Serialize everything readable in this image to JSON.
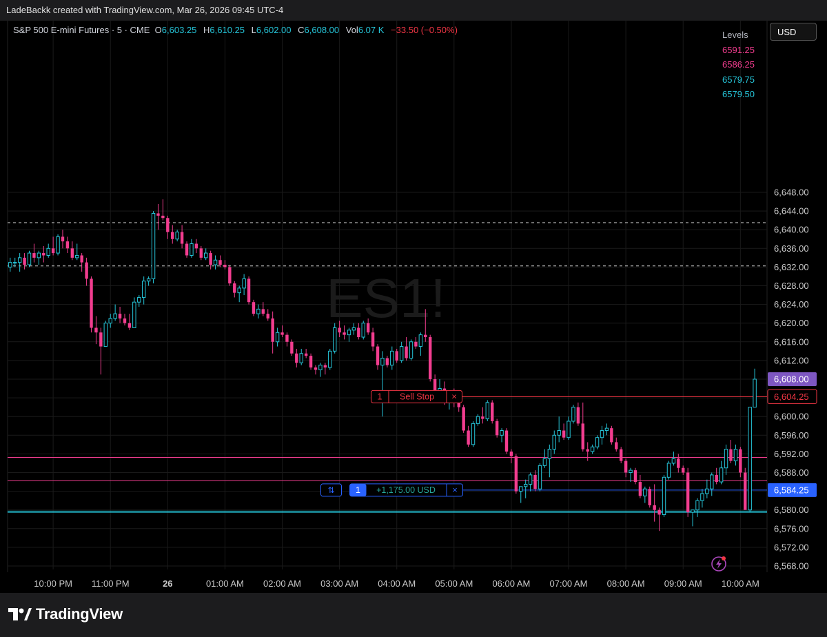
{
  "attribution": "LadeBackk created with TradingView.com, Mar 26, 2026 09:45 UTC-4",
  "brand": "TradingView",
  "watermark": "ES1!",
  "symbol_header": {
    "title": "S&P 500 E-mini Futures · 5 · CME",
    "o_label": "O",
    "o_value": "6,603.25",
    "h_label": "H",
    "h_value": "6,610.25",
    "l_label": "L",
    "l_value": "6,602.00",
    "c_label": "C",
    "c_value": "6,608.00",
    "vol_label": "Vol",
    "vol_value": "6.07 K",
    "change": "−33.50 (−0.50%)"
  },
  "currency_button": "USD",
  "levels_panel": {
    "title": "Levels",
    "items": [
      {
        "label": "6591.25",
        "color": "#f23d8f"
      },
      {
        "label": "6586.25",
        "color": "#f23d8f"
      },
      {
        "label": "6579.75",
        "color": "#26c6da"
      },
      {
        "label": "6579.50",
        "color": "#26c6da"
      }
    ]
  },
  "order": {
    "qty": "1",
    "label": "Sell Stop",
    "close": "×",
    "price": 6604.25,
    "price_label": "6,604.25",
    "color": "#f23645"
  },
  "position": {
    "icon": "swap-icon",
    "qty": "1",
    "pnl": "+1,175.00 USD",
    "close": "×",
    "price": 6584.25,
    "price_label": "6,584.25",
    "color": "#2962ff",
    "pnl_color": "#26a69a"
  },
  "last_price": {
    "price": 6608,
    "label": "6,608.00",
    "color": "#7e57c2"
  },
  "colors": {
    "up": "#26c6da",
    "down": "#f23d8f",
    "grid": "#1a1a1a",
    "axis_text": "#c9c9c9",
    "dashed": "#d8d8d8"
  },
  "chart_data": {
    "type": "candlestick",
    "symbol": "ES1!",
    "interval": "5",
    "y_axis": {
      "ticks": [
        6568,
        6572,
        6576,
        6580,
        6584,
        6588,
        6592,
        6596,
        6600,
        6604,
        6608,
        6612,
        6616,
        6620,
        6624,
        6628,
        6632,
        6636,
        6640,
        6644,
        6648
      ],
      "tick_labels": [
        "6,568.00",
        "6,572.00",
        "6,576.00",
        "6,580.00",
        "6,584.00",
        "6,588.00",
        "6,592.00",
        "6,596.00",
        "6,600.00",
        "6,604.00",
        "6,608.00",
        "6,612.00",
        "6,616.00",
        "6,620.00",
        "6,624.00",
        "6,628.00",
        "6,632.00",
        "6,636.00",
        "6,640.00",
        "6,644.00",
        "6,648.00"
      ],
      "range": [
        6567,
        6651
      ]
    },
    "x_axis": {
      "tick_labels": [
        "10:00 PM",
        "11:00 PM",
        "26",
        "01:00 AM",
        "02:00 AM",
        "03:00 AM",
        "04:00 AM",
        "05:00 AM",
        "06:00 AM",
        "07:00 AM",
        "08:00 AM",
        "09:00 AM",
        "10:00 AM"
      ],
      "tick_bars": [
        9,
        21,
        33,
        45,
        57,
        69,
        81,
        93,
        105,
        117,
        129,
        141,
        153
      ],
      "bold": [
        "26"
      ],
      "last_bar": 149
    },
    "horizontal_lines": [
      {
        "price": 6641.5,
        "style": "dashed",
        "color": "#d8d8d8"
      },
      {
        "price": 6632.25,
        "style": "dashed",
        "color": "#d8d8d8"
      },
      {
        "price": 6591.25,
        "style": "solid",
        "color": "#f23d8f"
      },
      {
        "price": 6586.25,
        "style": "solid",
        "color": "#f23d8f"
      },
      {
        "price": 6579.75,
        "style": "solid",
        "color": "#26c6da"
      },
      {
        "price": 6579.5,
        "style": "solid",
        "color": "#26c6da"
      }
    ],
    "candles": [
      [
        6632,
        6634,
        6631,
        6633
      ],
      [
        6633,
        6634,
        6632,
        6633
      ],
      [
        6633,
        6635,
        6631,
        6634
      ],
      [
        6634,
        6635,
        6631.5,
        6632.5
      ],
      [
        6632.5,
        6635.5,
        6632,
        6635
      ],
      [
        6635,
        6637,
        6633,
        6634
      ],
      [
        6634,
        6635.5,
        6632.5,
        6635
      ],
      [
        6635,
        6636.5,
        6633,
        6634.5
      ],
      [
        6634.5,
        6637,
        6634,
        6636
      ],
      [
        6636,
        6638.5,
        6634.5,
        6635
      ],
      [
        6635,
        6639,
        6634.5,
        6638.5
      ],
      [
        6638.5,
        6640,
        6636,
        6637.5
      ],
      [
        6637.5,
        6638.5,
        6635,
        6636
      ],
      [
        6636,
        6637.5,
        6633.5,
        6634
      ],
      [
        6634,
        6637,
        6633.5,
        6634.5
      ],
      [
        6634.5,
        6635,
        6631,
        6633
      ],
      [
        6633,
        6634,
        6628,
        6629.5
      ],
      [
        6629.5,
        6630,
        6618,
        6619
      ],
      [
        6619,
        6621.5,
        6615.5,
        6618
      ],
      [
        6618,
        6619,
        6609,
        6615
      ],
      [
        6615,
        6620.5,
        6615,
        6620
      ],
      [
        6620,
        6622,
        6619,
        6621
      ],
      [
        6621,
        6624,
        6620.5,
        6622
      ],
      [
        6622,
        6623.5,
        6620,
        6621
      ],
      [
        6621,
        6622,
        6619.5,
        6620
      ],
      [
        6620,
        6622,
        6618.5,
        6619
      ],
      [
        6619,
        6625.5,
        6619,
        6624.5
      ],
      [
        6624.5,
        6626,
        6623.5,
        6625.5
      ],
      [
        6625.5,
        6630,
        6624,
        6629
      ],
      [
        6629,
        6630,
        6628,
        6629.5
      ],
      [
        6629.5,
        6644,
        6628.5,
        6643.5
      ],
      [
        6643.5,
        6645.5,
        6640,
        6643
      ],
      [
        6643,
        6646.5,
        6642,
        6642.5
      ],
      [
        6642.5,
        6643,
        6638,
        6639.5
      ],
      [
        6639.5,
        6641,
        6637,
        6638
      ],
      [
        6638,
        6640,
        6637.5,
        6639.5
      ],
      [
        6639.5,
        6641,
        6636,
        6637
      ],
      [
        6637,
        6637.5,
        6634,
        6634.5
      ],
      [
        6634.5,
        6638,
        6634,
        6637
      ],
      [
        6637,
        6638,
        6635,
        6636
      ],
      [
        6636,
        6636.5,
        6633.5,
        6634
      ],
      [
        6634,
        6636,
        6633.5,
        6635
      ],
      [
        6635,
        6635.5,
        6631.5,
        6632.5
      ],
      [
        6632.5,
        6634.5,
        6631.5,
        6633.5
      ],
      [
        6633.5,
        6634.5,
        6632,
        6632.5
      ],
      [
        6632.5,
        6633.5,
        6631.5,
        6632
      ],
      [
        6632,
        6632.5,
        6628,
        6628.5
      ],
      [
        6628.5,
        6629,
        6625.5,
        6626.5
      ],
      [
        6626.5,
        6628,
        6624.5,
        6627.5
      ],
      [
        6627.5,
        6630.5,
        6626,
        6629.5
      ],
      [
        6629.5,
        6630,
        6624,
        6624.5
      ],
      [
        6624.5,
        6625,
        6621.5,
        6622
      ],
      [
        6622,
        6624,
        6621,
        6623
      ],
      [
        6623,
        6624.5,
        6621.5,
        6622
      ],
      [
        6622,
        6623,
        6620.5,
        6621
      ],
      [
        6621,
        6622.5,
        6613.5,
        6616
      ],
      [
        6616,
        6619,
        6615,
        6618
      ],
      [
        6618,
        6619.5,
        6617,
        6617.5
      ],
      [
        6617.5,
        6618,
        6615,
        6616
      ],
      [
        6616,
        6616.5,
        6613,
        6613.5
      ],
      [
        6613.5,
        6614.5,
        6610.5,
        6611.5
      ],
      [
        6611.5,
        6614.5,
        6611,
        6613.5
      ],
      [
        6613.5,
        6614.5,
        6612.5,
        6613
      ],
      [
        6613,
        6613.5,
        6610,
        6610.5
      ],
      [
        6610.5,
        6611,
        6609,
        6610
      ],
      [
        6610,
        6611.5,
        6608.5,
        6611
      ],
      [
        6611,
        6611.5,
        6609,
        6610.5
      ],
      [
        6610.5,
        6614.5,
        6610,
        6614
      ],
      [
        6614,
        6620,
        6613.5,
        6619
      ],
      [
        6619,
        6620.5,
        6617,
        6618
      ],
      [
        6618,
        6619.5,
        6616.5,
        6617.5
      ],
      [
        6617.5,
        6619,
        6616,
        6618.5
      ],
      [
        6618.5,
        6620,
        6617.5,
        6619
      ],
      [
        6619,
        6620,
        6616.5,
        6617
      ],
      [
        6617,
        6620.5,
        6616.5,
        6620
      ],
      [
        6620,
        6621,
        6617.5,
        6618
      ],
      [
        6618,
        6619,
        6614,
        6615
      ],
      [
        6615,
        6615.5,
        6610,
        6611
      ],
      [
        6611,
        6614,
        6600,
        6612.5
      ],
      [
        6612.5,
        6613,
        6610.5,
        6611
      ],
      [
        6611,
        6615,
        6610,
        6614
      ],
      [
        6614,
        6614.5,
        6611.5,
        6612
      ],
      [
        6612,
        6616,
        6611.5,
        6615
      ],
      [
        6615,
        6617,
        6612,
        6612.5
      ],
      [
        6612.5,
        6616.5,
        6612,
        6616
      ],
      [
        6616,
        6617,
        6614.5,
        6615
      ],
      [
        6615,
        6618,
        6613,
        6617.5
      ],
      [
        6617.5,
        6623,
        6616,
        6617
      ],
      [
        6617,
        6617.5,
        6607.5,
        6608
      ],
      [
        6608,
        6609,
        6604,
        6605.5
      ],
      [
        6605.5,
        6608,
        6604,
        6606
      ],
      [
        6606,
        6607.5,
        6602.5,
        6603
      ],
      [
        6603,
        6605.5,
        6601.5,
        6605
      ],
      [
        6605,
        6606,
        6602,
        6603
      ],
      [
        6603,
        6605,
        6601,
        6602
      ],
      [
        6602,
        6602.5,
        6596.5,
        6597
      ],
      [
        6597,
        6598,
        6593.5,
        6594
      ],
      [
        6594,
        6599,
        6593.5,
        6598.5
      ],
      [
        6598.5,
        6600.5,
        6598,
        6600
      ],
      [
        6600,
        6602,
        6598.5,
        6599.5
      ],
      [
        6599.5,
        6603.5,
        6599,
        6603
      ],
      [
        6603,
        6603.5,
        6598.5,
        6599
      ],
      [
        6599,
        6599.5,
        6595.5,
        6596
      ],
      [
        6596,
        6597.5,
        6594.5,
        6597
      ],
      [
        6597,
        6597.5,
        6592,
        6592.5
      ],
      [
        6592.5,
        6593,
        6590,
        6591.5
      ],
      [
        6591.5,
        6592,
        6583.5,
        6584
      ],
      [
        6584,
        6585,
        6581.5,
        6585
      ],
      [
        6585,
        6586.5,
        6582.5,
        6585.5
      ],
      [
        6585.5,
        6588,
        6584,
        6587.5
      ],
      [
        6587.5,
        6588.5,
        6584,
        6584.5
      ],
      [
        6584.5,
        6590,
        6584,
        6589.5
      ],
      [
        6589.5,
        6593,
        6589,
        6591
      ],
      [
        6591,
        6594,
        6587,
        6593
      ],
      [
        6593,
        6597,
        6592,
        6596
      ],
      [
        6596,
        6600,
        6594.5,
        6597
      ],
      [
        6597,
        6598.5,
        6595,
        6595.5
      ],
      [
        6595.5,
        6600,
        6595,
        6599
      ],
      [
        6599,
        6602.5,
        6598.5,
        6602
      ],
      [
        6602,
        6603,
        6598,
        6598.5
      ],
      [
        6598.5,
        6603,
        6592.5,
        6593
      ],
      [
        6593,
        6594.5,
        6590.5,
        6592.5
      ],
      [
        6592.5,
        6594,
        6592,
        6593.5
      ],
      [
        6593.5,
        6596,
        6593,
        6595.5
      ],
      [
        6595.5,
        6598,
        6594,
        6597
      ],
      [
        6597,
        6598.5,
        6596,
        6597.5
      ],
      [
        6597.5,
        6598,
        6594,
        6594.5
      ],
      [
        6594.5,
        6595.5,
        6592.5,
        6593
      ],
      [
        6593,
        6593.5,
        6590,
        6590.5
      ],
      [
        6590.5,
        6591,
        6587,
        6588
      ],
      [
        6588,
        6589,
        6586,
        6588.5
      ],
      [
        6588.5,
        6589,
        6585.5,
        6586
      ],
      [
        6586,
        6587.5,
        6582.5,
        6583
      ],
      [
        6583,
        6585,
        6581.5,
        6584.5
      ],
      [
        6584.5,
        6585,
        6580.5,
        6581
      ],
      [
        6581,
        6585.5,
        6577.5,
        6580
      ],
      [
        6580,
        6580.5,
        6575.5,
        6579
      ],
      [
        6579,
        6587.5,
        6578.5,
        6587
      ],
      [
        6587,
        6590.5,
        6586.5,
        6590
      ],
      [
        6590,
        6592.5,
        6589.5,
        6591
      ],
      [
        6591,
        6592,
        6588,
        6589
      ],
      [
        6589,
        6589.5,
        6587.5,
        6588
      ],
      [
        6588,
        6589,
        6578.5,
        6579.5
      ],
      [
        6579.5,
        6580,
        6576.5,
        6580
      ],
      [
        6580,
        6582.5,
        6578.5,
        6582
      ],
      [
        6582,
        6584.5,
        6580.5,
        6583.5
      ],
      [
        6583.5,
        6586.5,
        6582.5,
        6584.5
      ],
      [
        6584.5,
        6588,
        6583,
        6587.5
      ],
      [
        6587.5,
        6589,
        6585.5,
        6586
      ],
      [
        6586,
        6590.5,
        6585.5,
        6589
      ],
      [
        6589,
        6594,
        6587.5,
        6593
      ],
      [
        6593,
        6595,
        6590,
        6590.5
      ],
      [
        6590.5,
        6594,
        6589.5,
        6593
      ],
      [
        6593,
        6593.5,
        6587,
        6588
      ],
      [
        6588,
        6589,
        6581,
        6580
      ],
      [
        6580,
        6600,
        6579.5,
        6602
      ],
      [
        6602,
        6610.25,
        6602,
        6608
      ]
    ]
  }
}
